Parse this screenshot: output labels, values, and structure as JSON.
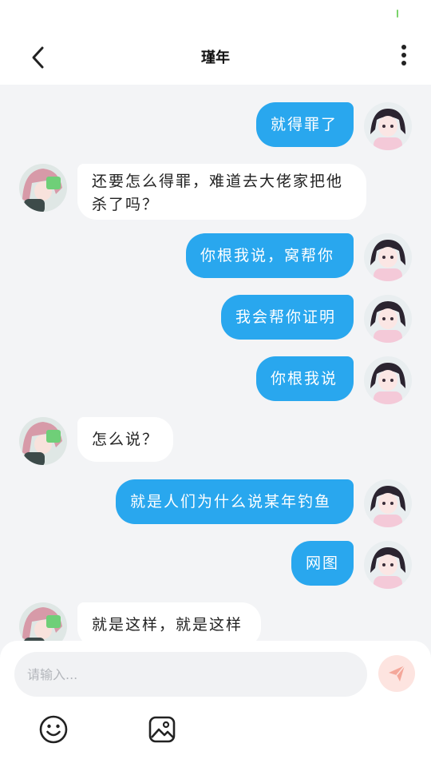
{
  "header": {
    "title": "瑾年",
    "back_icon": "chevron-left-icon",
    "more_icon": "more-vertical-icon"
  },
  "colors": {
    "accent": "#29a7ee",
    "chat_bg": "#f3f4f6",
    "send_button_bg": "#fde4e0"
  },
  "messages": [
    {
      "side": "right",
      "text": "就得罪了"
    },
    {
      "side": "left",
      "text": "还要怎么得罪，难道去大佬家把他\n杀了吗？"
    },
    {
      "side": "right",
      "text": "你根我说，窝帮你"
    },
    {
      "side": "right",
      "text": "我会帮你证明"
    },
    {
      "side": "right",
      "text": "你根我说"
    },
    {
      "side": "left",
      "text": "怎么说？"
    },
    {
      "side": "right",
      "text": "就是人们为什么说某年钓鱼"
    },
    {
      "side": "right",
      "text": "网图"
    },
    {
      "side": "left",
      "text": "就是这样，就是这样"
    }
  ],
  "composer": {
    "placeholder": "请输入...",
    "send_icon": "send-icon",
    "emoji_icon": "emoji-icon",
    "image_icon": "image-icon"
  }
}
